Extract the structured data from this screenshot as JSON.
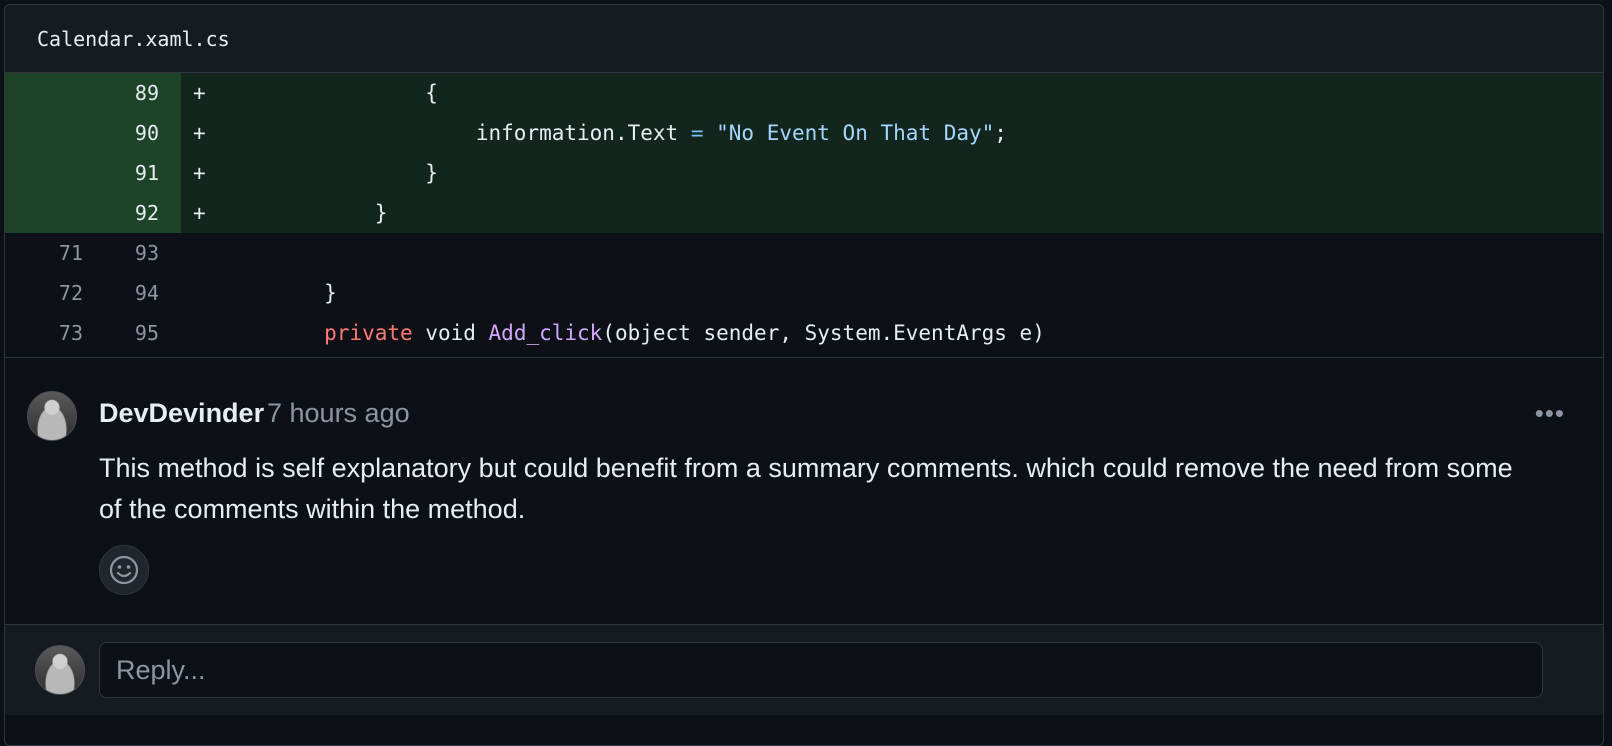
{
  "file": {
    "name": "Calendar.xaml.cs"
  },
  "diff": {
    "rows": [
      {
        "old": "",
        "new": "89",
        "marker": "+",
        "indent": "                ",
        "tokens": [
          [
            "",
            "{"
          ]
        ]
      },
      {
        "old": "",
        "new": "90",
        "marker": "+",
        "indent": "                    ",
        "tokens": [
          [
            "",
            "information.Text "
          ],
          [
            "op",
            "="
          ],
          [
            "",
            " "
          ],
          [
            "str",
            "\"No Event On That Day\""
          ],
          [
            "",
            ";"
          ]
        ]
      },
      {
        "old": "",
        "new": "91",
        "marker": "+",
        "indent": "                ",
        "tokens": [
          [
            "",
            "}"
          ]
        ]
      },
      {
        "old": "",
        "new": "92",
        "marker": "+",
        "indent": "            ",
        "tokens": [
          [
            "",
            "}"
          ]
        ]
      },
      {
        "old": "71",
        "new": "93",
        "marker": "",
        "indent": "",
        "tokens": []
      },
      {
        "old": "72",
        "new": "94",
        "marker": "",
        "indent": "        ",
        "tokens": [
          [
            "",
            "}"
          ]
        ]
      },
      {
        "old": "73",
        "new": "95",
        "marker": "",
        "indent": "        ",
        "tokens": [
          [
            "kw",
            "private"
          ],
          [
            "",
            " void "
          ],
          [
            "fn",
            "Add_click"
          ],
          [
            "",
            "(object sender, System.EventArgs e)"
          ]
        ]
      }
    ]
  },
  "comment": {
    "author": "DevDevinder",
    "time": "7 hours ago",
    "more_label": "•••",
    "body": "This method is self explanatory but could benefit from a summary comments. which could remove the need from some of the comments within the method."
  },
  "reply": {
    "placeholder": "Reply..."
  },
  "icons": {
    "avatar": "user-avatar",
    "reaction": "smiley-icon",
    "more": "kebab-menu-icon"
  },
  "colors": {
    "added_bg": "#12261e",
    "added_gutter": "#1d4428",
    "keyword": "#ff7b72",
    "function": "#d2a8ff",
    "string": "#a5d6ff"
  }
}
